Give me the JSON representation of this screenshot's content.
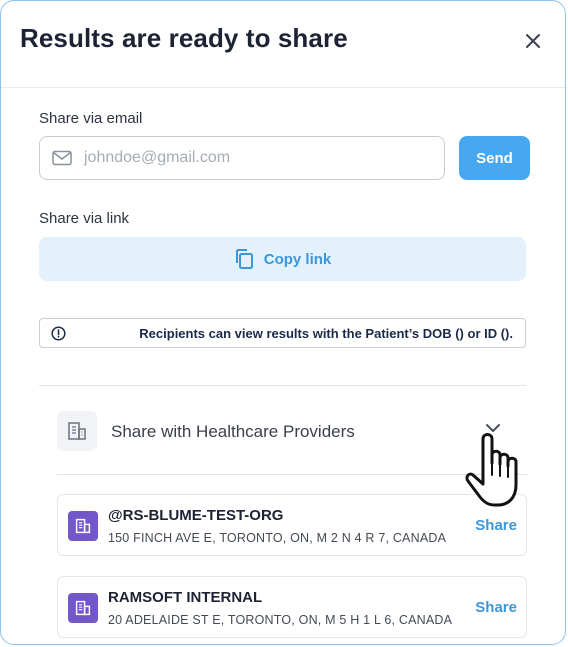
{
  "dialog": {
    "title": "Results are ready to share",
    "email": {
      "label": "Share via email",
      "placeholder": "johndoe@gmail.com",
      "send_label": "Send"
    },
    "link": {
      "label": "Share via link",
      "copy_label": "Copy link"
    },
    "notice": "Recipients can view results with the Patient’s DOB () or ID ().",
    "providers": {
      "label": "Share with Healthcare Providers",
      "items": [
        {
          "name": "@RS-BLUME-TEST-ORG",
          "address": "150 FINCH AVE E, TORONTO, ON, M 2 N 4 R 7, CANADA",
          "action": "Share"
        },
        {
          "name": "RAMSOFT INTERNAL",
          "address": "20 ADELAIDE ST E, TORONTO, ON, M 5 H 1 L 6, CANADA",
          "action": "Share"
        }
      ]
    }
  },
  "colors": {
    "accent": "#46a8f0",
    "link_text": "#3a97db",
    "copy_bg": "#e3f1fc",
    "org_icon_bg": "#7357c8",
    "dialog_border": "#8ec5f0"
  },
  "icons": [
    "close-icon",
    "mail-icon",
    "copy-icon",
    "info-icon",
    "building-icon",
    "chevron-down-icon",
    "hand-pointer-icon"
  ]
}
